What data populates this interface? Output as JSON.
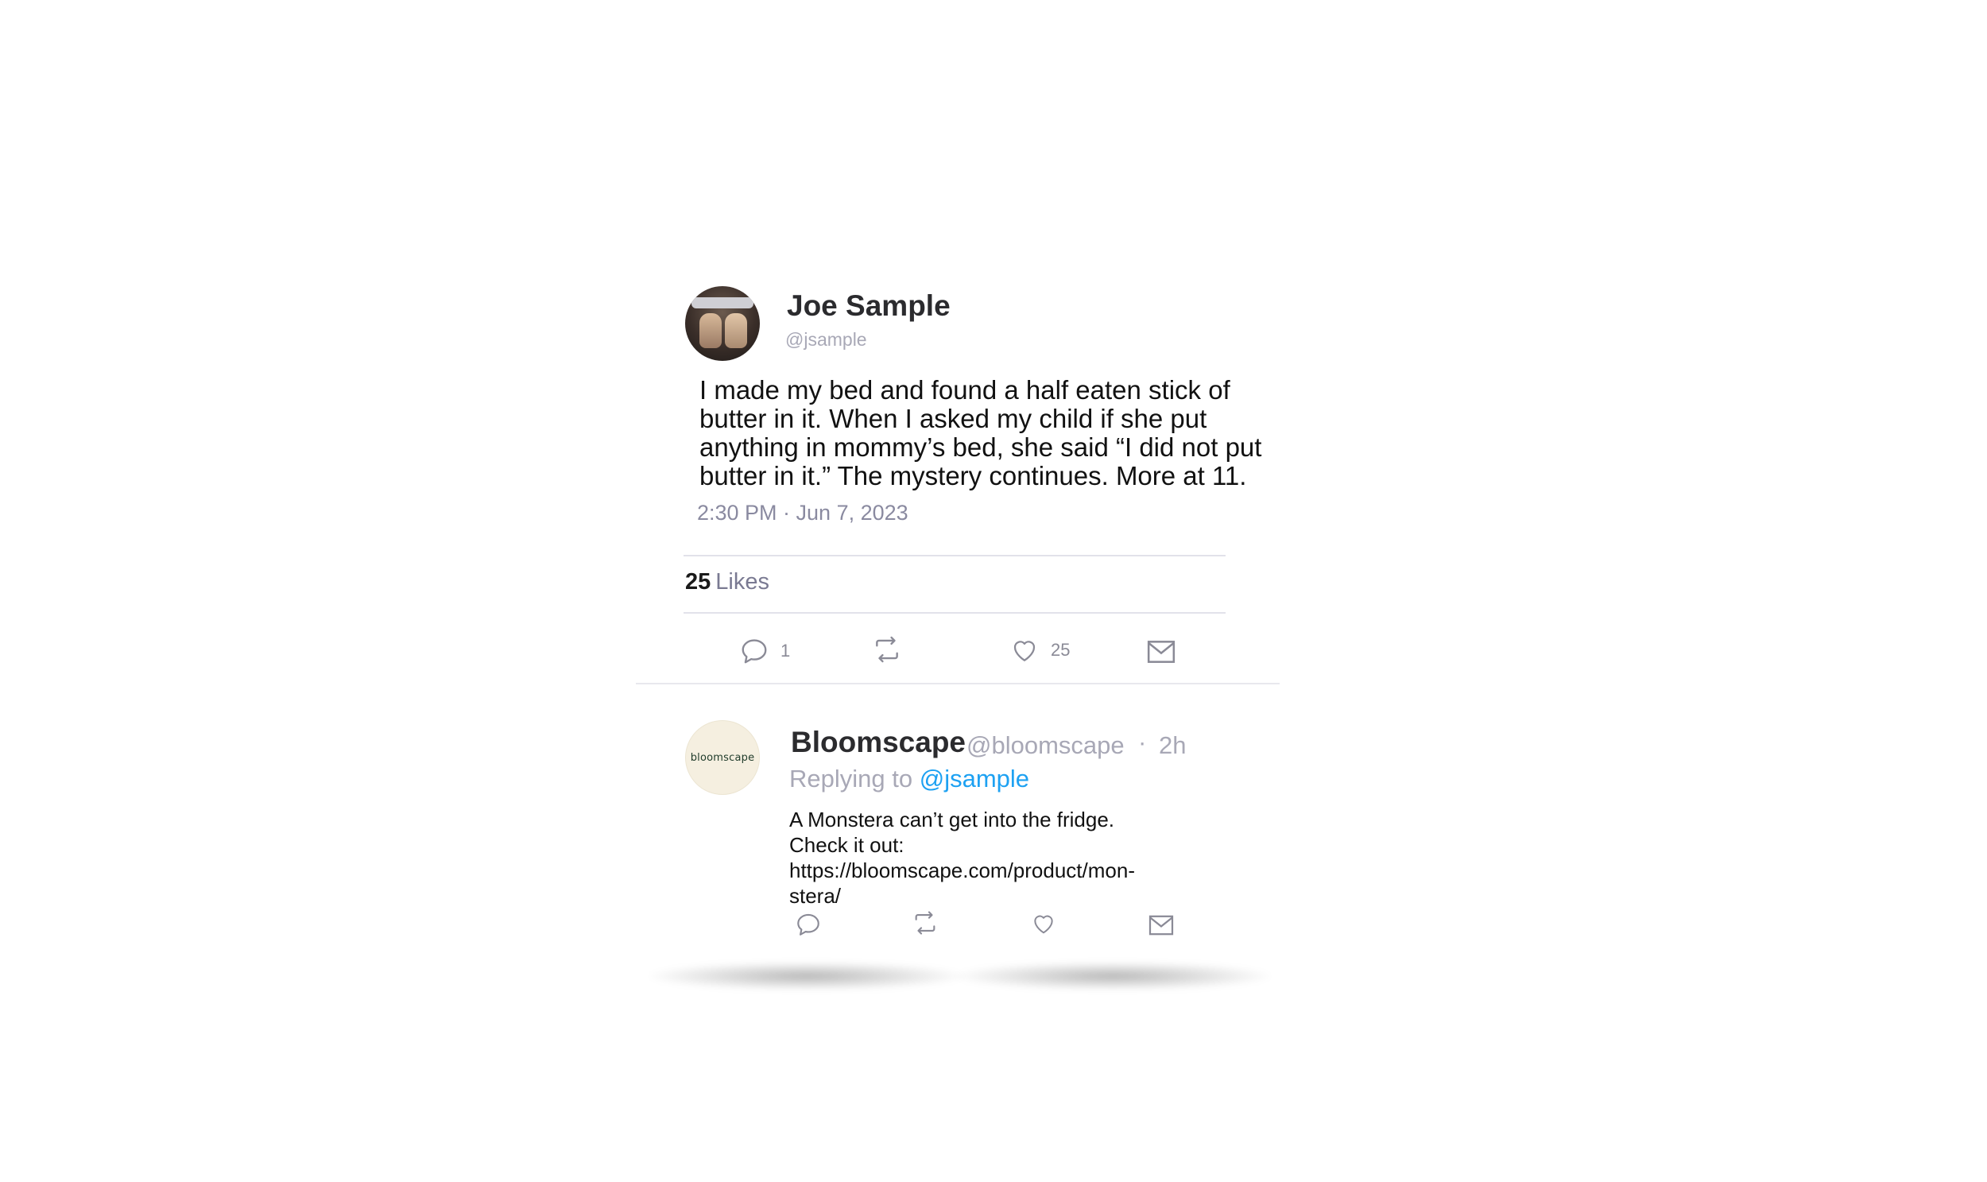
{
  "tweet": {
    "author_name": "Joe Sample",
    "author_handle": "@jsample",
    "text": "I made my bed and found a half eaten stick of butter in it. When I asked my child if she put anything in mommy’s bed, she said “I did not put butter in it.” The mystery continues. More at 11.",
    "timestamp": "2:30 PM · Jun 7, 2023",
    "likes_count": "25",
    "likes_label": "Likes",
    "actions": {
      "reply_count": "1",
      "like_count": "25",
      "icons": [
        "reply-icon",
        "retweet-icon",
        "heart-icon",
        "mail-icon"
      ]
    }
  },
  "reply": {
    "author_name": "Bloomscape",
    "author_handle": "@bloomscape",
    "separator": "·",
    "time": "2h",
    "replying_label": "Replying to",
    "replying_handle": "@jsample",
    "text_lines": [
      "A Monstera can’t get into the fridge.",
      "Check it out:",
      "https://bloomscape.com/product/mon-",
      "stera/"
    ],
    "avatar_logo": "bloomscape",
    "icons": [
      "reply-icon",
      "retweet-icon",
      "heart-icon",
      "mail-icon"
    ]
  },
  "colors": {
    "link": "#1da1f2",
    "muted": "#a8a8b6",
    "text": "#111111",
    "avatar_bg": "#f5efe0"
  }
}
